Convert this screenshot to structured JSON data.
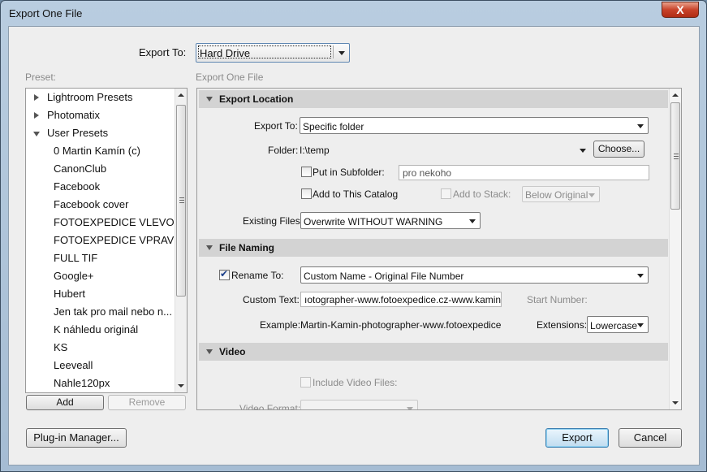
{
  "window": {
    "title": "Export One File",
    "close_glyph": "X"
  },
  "export_to": {
    "label": "Export To:",
    "value": "Hard Drive"
  },
  "preset": {
    "label": "Preset:",
    "groups": [
      {
        "label": "Lightroom Presets",
        "expanded": false
      },
      {
        "label": "Photomatix",
        "expanded": false
      },
      {
        "label": "User Presets",
        "expanded": true
      }
    ],
    "items": [
      "0 Martin Kamín (c)",
      "CanonClub",
      "Facebook",
      "Facebook cover",
      "FOTOEXPEDICE VLEVO",
      "FOTOEXPEDICE VPRAVO",
      "FULL TIF",
      "Google+",
      "Hubert",
      "Jen tak pro mail nebo n...",
      "K náhledu originál",
      "KS",
      "Leeveall",
      "Nahle120px"
    ],
    "add_label": "Add",
    "remove_label": "Remove"
  },
  "panel_title": "Export One File",
  "export_location": {
    "header": "Export Location",
    "export_to_label": "Export To:",
    "export_to_value": "Specific folder",
    "folder_label": "Folder:",
    "folder_value": "I:\\temp",
    "choose_label": "Choose...",
    "subfolder_label": "Put in Subfolder:",
    "subfolder_value": "pro nekoho",
    "add_catalog_label": "Add to This Catalog",
    "add_stack_label": "Add to Stack:",
    "stack_value": "Below Original",
    "existing_label": "Existing Files:",
    "existing_value": "Overwrite WITHOUT WARNING"
  },
  "file_naming": {
    "header": "File Naming",
    "rename_label": "Rename To:",
    "rename_value": "Custom Name - Original File Number",
    "custom_text_label": "Custom Text:",
    "custom_text_value": "ıotographer-www.fotoexpedice.cz-www.kamin.cz",
    "start_number_label": "Start Number:",
    "example_label": "Example:",
    "example_value": "Martin-Kamin-photographer-www.fotoexpedice.cz-w",
    "extensions_label": "Extensions:",
    "extensions_value": "Lowercase"
  },
  "video": {
    "header": "Video",
    "include_label": "Include Video Files:",
    "format_label": "Video Format:"
  },
  "footer": {
    "plugin_label": "Plug-in Manager...",
    "export_label": "Export",
    "cancel_label": "Cancel"
  }
}
